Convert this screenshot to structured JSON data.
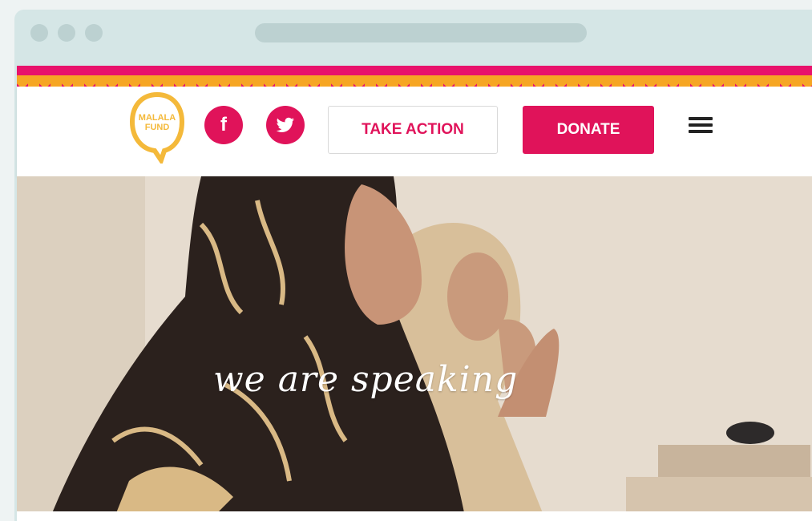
{
  "browser": {
    "window_controls": [
      "close-dot",
      "minimize-dot",
      "maximize-dot"
    ]
  },
  "header": {
    "logo_text_line1": "MALALA",
    "logo_text_line2": "FUND",
    "social": [
      {
        "name": "facebook",
        "glyph": "f"
      },
      {
        "name": "twitter",
        "glyph": "twitter-bird"
      }
    ],
    "take_action_label": "TAKE ACTION",
    "donate_label": "DONATE",
    "menu_icon": "hamburger-menu"
  },
  "hero": {
    "caption": "we are speaking"
  },
  "colors": {
    "brand_pink": "#e0135a",
    "brand_yellow": "#f4b93a",
    "browser_chrome": "#d5e6e6"
  }
}
